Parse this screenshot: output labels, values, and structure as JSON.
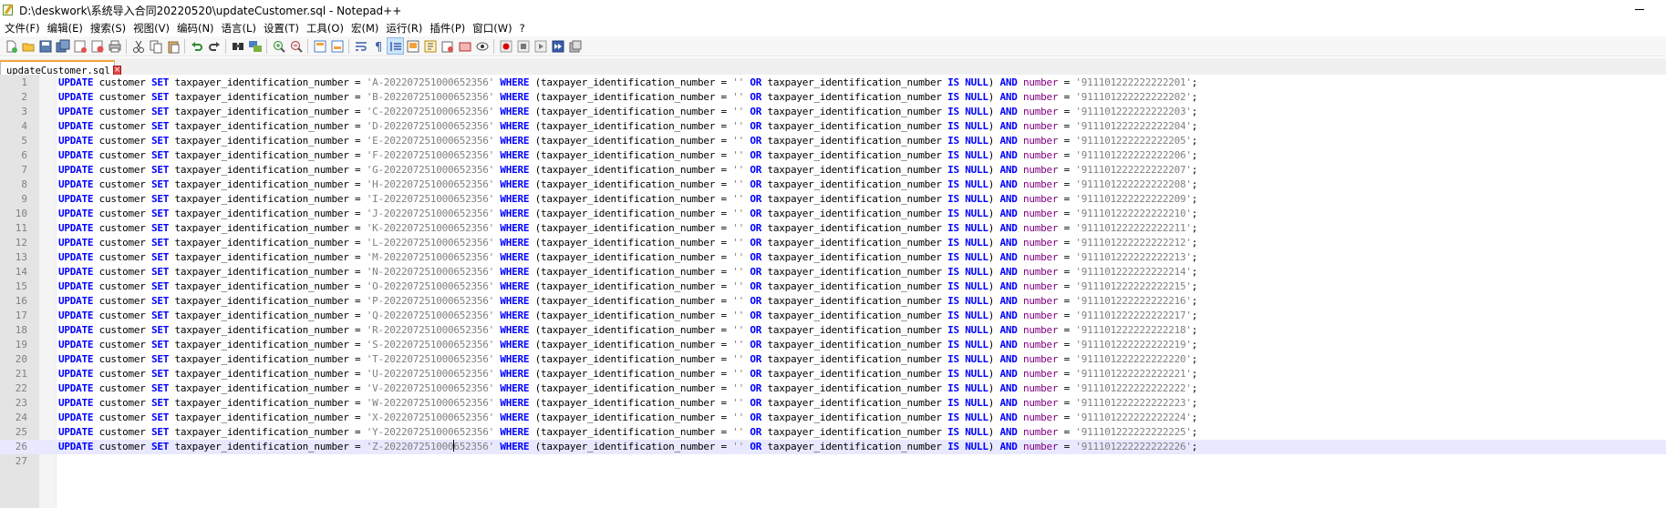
{
  "window": {
    "title": "D:\\deskwork\\系统导入合同20220520\\updateCustomer.sql - Notepad++"
  },
  "menu": [
    {
      "label": "文件(F)"
    },
    {
      "label": "编辑(E)"
    },
    {
      "label": "搜索(S)"
    },
    {
      "label": "视图(V)"
    },
    {
      "label": "编码(N)"
    },
    {
      "label": "语言(L)"
    },
    {
      "label": "设置(T)"
    },
    {
      "label": "工具(O)"
    },
    {
      "label": "宏(M)"
    },
    {
      "label": "运行(R)"
    },
    {
      "label": "插件(P)"
    },
    {
      "label": "窗口(W)"
    },
    {
      "label": "?"
    }
  ],
  "toolbar": {
    "buttons": [
      "new-file-icon",
      "open-file-icon",
      "save-icon",
      "save-all-icon",
      "close-icon",
      "close-all-icon",
      "print-icon",
      "|",
      "cut-icon",
      "copy-icon",
      "paste-icon",
      "|",
      "undo-icon",
      "redo-icon",
      "|",
      "find-icon",
      "replace-icon",
      "|",
      "zoom-in-icon",
      "zoom-out-icon",
      "|",
      "sync-vertical-icon",
      "sync-horizontal-icon",
      "|",
      "word-wrap-icon",
      "show-all-characters-icon",
      "indent-guide-icon",
      "document-map-icon",
      "function-list-icon",
      "folder-as-workspace-icon",
      "document-list-icon",
      "monitoring-icon",
      "|",
      "record-macro-icon",
      "stop-macro-icon",
      "play-macro-icon",
      "run-macro-multiple-icon",
      "save-macro-icon"
    ],
    "active_button": "indent-guide-icon"
  },
  "tabs": [
    {
      "label": "updateCustomer.sql",
      "active": true
    }
  ],
  "editor": {
    "current_line": 26,
    "caret": {
      "line": 26,
      "column": 38
    },
    "lines": [
      {
        "n": "1",
        "letter": "A",
        "number": "911101222222222201"
      },
      {
        "n": "2",
        "letter": "B",
        "number": "911101222222222202"
      },
      {
        "n": "3",
        "letter": "C",
        "number": "911101222222222203"
      },
      {
        "n": "4",
        "letter": "D",
        "number": "911101222222222204"
      },
      {
        "n": "5",
        "letter": "E",
        "number": "911101222222222205"
      },
      {
        "n": "6",
        "letter": "F",
        "number": "911101222222222206"
      },
      {
        "n": "7",
        "letter": "G",
        "number": "911101222222222207"
      },
      {
        "n": "8",
        "letter": "H",
        "number": "911101222222222208"
      },
      {
        "n": "9",
        "letter": "I",
        "number": "911101222222222209"
      },
      {
        "n": "10",
        "letter": "J",
        "number": "911101222222222210"
      },
      {
        "n": "11",
        "letter": "K",
        "number": "911101222222222211"
      },
      {
        "n": "12",
        "letter": "L",
        "number": "911101222222222212"
      },
      {
        "n": "13",
        "letter": "M",
        "number": "911101222222222213"
      },
      {
        "n": "14",
        "letter": "N",
        "number": "911101222222222214"
      },
      {
        "n": "15",
        "letter": "O",
        "number": "911101222222222215"
      },
      {
        "n": "16",
        "letter": "P",
        "number": "911101222222222216"
      },
      {
        "n": "17",
        "letter": "Q",
        "number": "911101222222222217"
      },
      {
        "n": "18",
        "letter": "R",
        "number": "911101222222222218"
      },
      {
        "n": "19",
        "letter": "S",
        "number": "911101222222222219"
      },
      {
        "n": "20",
        "letter": "T",
        "number": "911101222222222220"
      },
      {
        "n": "21",
        "letter": "U",
        "number": "911101222222222221"
      },
      {
        "n": "22",
        "letter": "V",
        "number": "911101222222222222"
      },
      {
        "n": "23",
        "letter": "W",
        "number": "911101222222222223"
      },
      {
        "n": "24",
        "letter": "X",
        "number": "911101222222222224"
      },
      {
        "n": "25",
        "letter": "Y",
        "number": "911101222222222225"
      },
      {
        "n": "26",
        "letter": "Z",
        "number": "911101222222222226"
      },
      {
        "n": "27",
        "empty": true
      }
    ],
    "statement": {
      "kw_update": "UPDATE",
      "table": " customer ",
      "kw_set": "SET",
      "col1": " taxpayer_identification_number = ",
      "id_suffix": "-202207251000652356",
      "kw_where": "WHERE",
      "cond1": " (taxpayer_identification_number = ",
      "empty_str": "''",
      "kw_or": "OR",
      "cond2": " taxpayer_identification_number ",
      "kw_is": "IS",
      "kw_null": "NULL",
      "close_paren": ") ",
      "kw_and": "AND",
      "number_col": "number",
      "eq": " = ",
      "semicolon": ";"
    }
  },
  "colors": {
    "keyword": "#0000ff",
    "string": "#808080",
    "current_line": "#e8e8ff",
    "tab_accent": "#f3a33a",
    "line_number": "#808080"
  }
}
